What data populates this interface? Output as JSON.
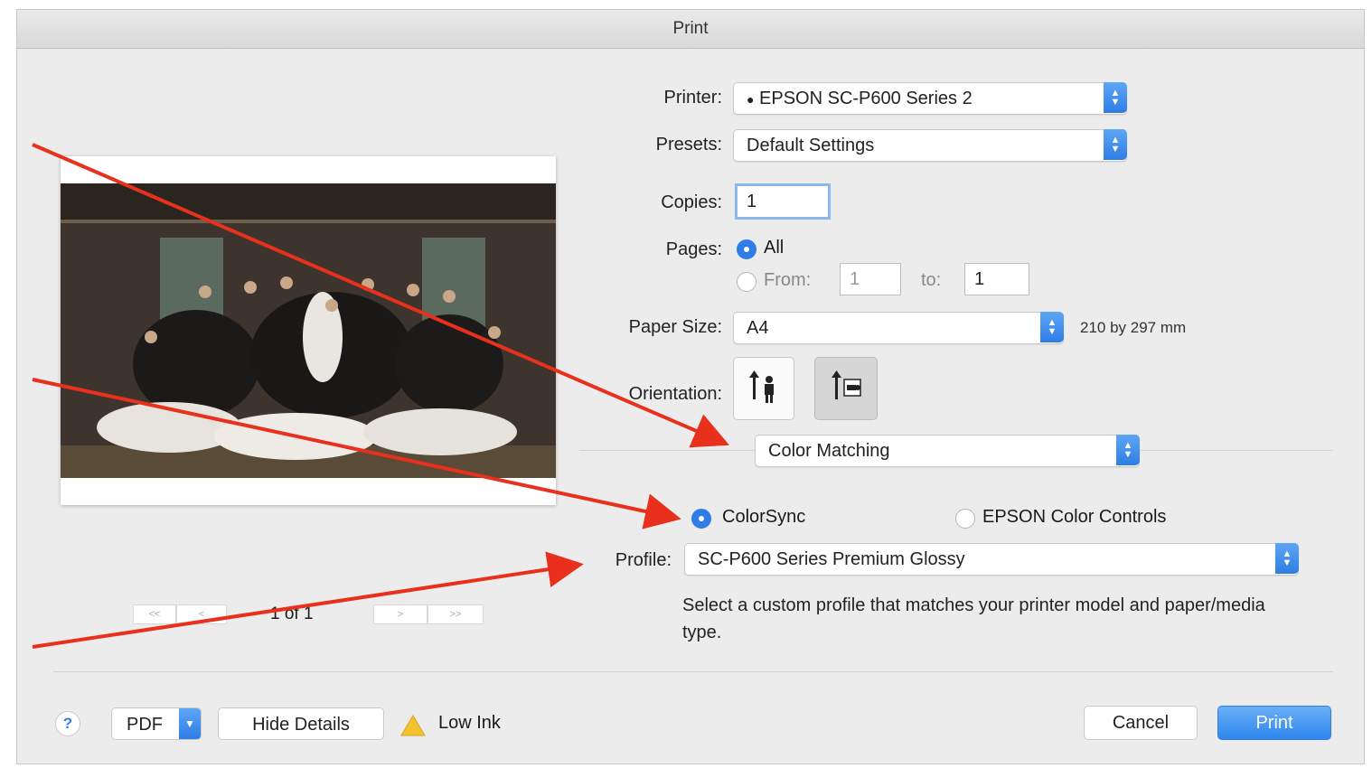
{
  "window": {
    "title": "Print"
  },
  "printer": {
    "label": "Printer:",
    "value": "EPSON SC-P600 Series 2"
  },
  "presets": {
    "label": "Presets:",
    "value": "Default Settings"
  },
  "copies": {
    "label": "Copies:",
    "value": "1"
  },
  "pages": {
    "label": "Pages:",
    "all_label": "All",
    "from_label": "From:",
    "from_value": "1",
    "to_label": "to:",
    "to_value": "1",
    "selected": "All"
  },
  "paper_size": {
    "label": "Paper Size:",
    "value": "A4",
    "dimensions": "210 by 297 mm"
  },
  "orientation": {
    "label": "Orientation:",
    "selected": "portrait"
  },
  "section_menu": {
    "value": "Color Matching"
  },
  "color_matching": {
    "colorsync_label": "ColorSync",
    "epson_label": "EPSON Color Controls",
    "selected": "ColorSync"
  },
  "profile": {
    "label": "Profile:",
    "value": "SC-P600 Series Premium Glossy",
    "help_text": "Select a custom profile that matches your printer model and paper/media type."
  },
  "preview": {
    "first_page": "<<",
    "prev_page": "<",
    "page_indicator": "1 of 1",
    "next_page": ">",
    "last_page": ">>"
  },
  "footer": {
    "help_label": "?",
    "pdf_label": "PDF",
    "hide_details_label": "Hide Details",
    "low_ink_label": "Low Ink",
    "cancel_label": "Cancel",
    "print_label": "Print"
  },
  "colors": {
    "accent": "#2f7de6",
    "annotation_arrow": "#e8301c"
  }
}
